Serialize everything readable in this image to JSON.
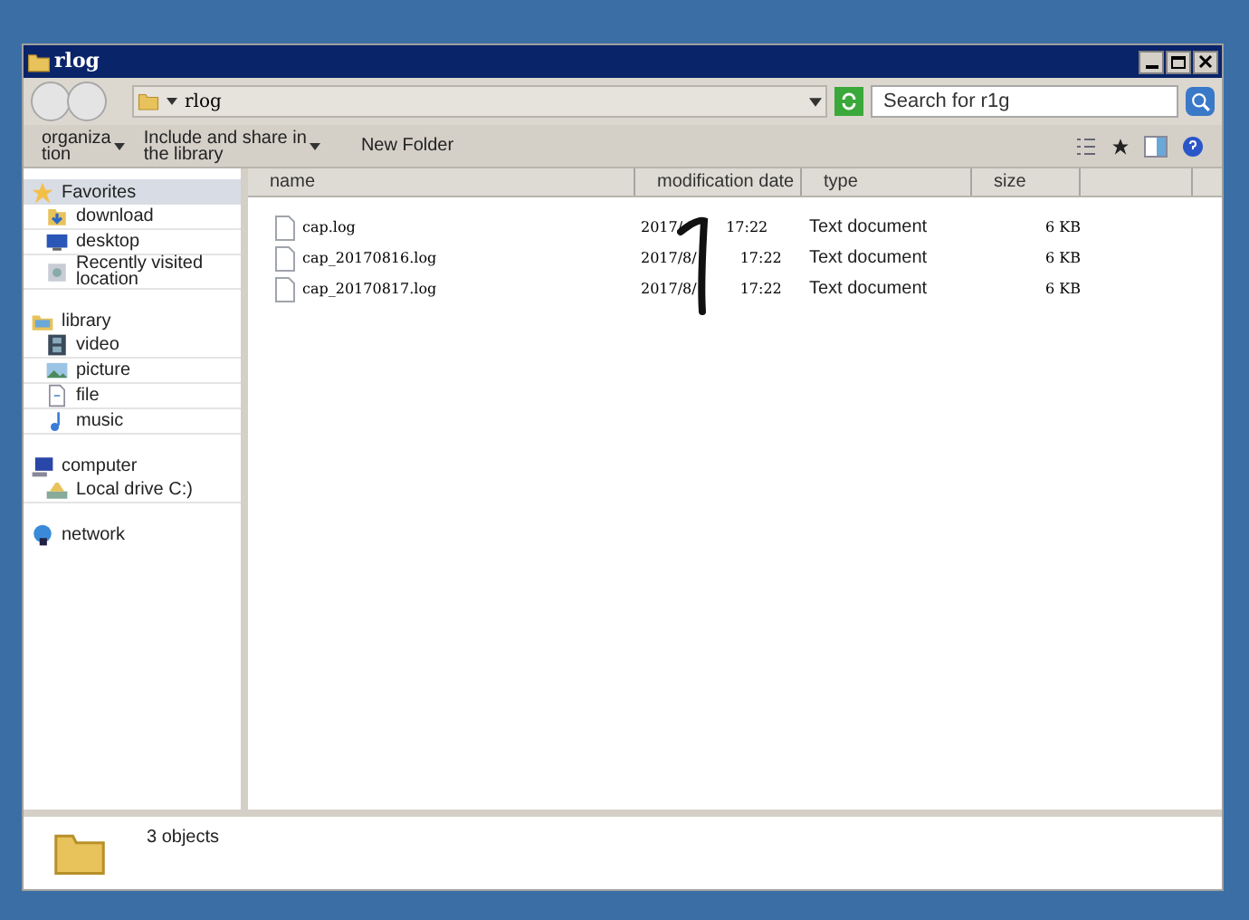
{
  "window": {
    "title": "rlog"
  },
  "address": {
    "path": "rlog"
  },
  "search": {
    "placeholder": "Search for r1g"
  },
  "toolbar": [
    {
      "lines": [
        "organiza",
        "tion"
      ]
    },
    {
      "lines": [
        "Include and share in",
        "the library"
      ]
    },
    {
      "lines": [
        "New Folder"
      ]
    }
  ],
  "sidebar": {
    "groups": [
      {
        "label": "Favorites",
        "selected": true,
        "children": [
          {
            "label": "download"
          },
          {
            "label": "desktop"
          },
          {
            "label": "Recently visited\nlocation"
          }
        ]
      },
      {
        "label": "library",
        "selected": false,
        "children": [
          {
            "label": "video"
          },
          {
            "label": "picture"
          },
          {
            "label": "file"
          },
          {
            "label": "music"
          }
        ]
      },
      {
        "label": "computer",
        "selected": false,
        "children": [
          {
            "label": "Local drive C:)"
          }
        ]
      },
      {
        "label": "network",
        "selected": false
      }
    ]
  },
  "table": {
    "columns": [
      "name",
      "modification date",
      "type",
      "size"
    ],
    "rows": [
      {
        "name": "cap.log",
        "date": "2017/",
        "time": "17:22",
        "type": "Text document",
        "size": "6 KB"
      },
      {
        "name": "cap_20170816.log",
        "date": "2017/8/",
        "time": "17:22",
        "type": "Text document",
        "size": "6 KB"
      },
      {
        "name": "cap_20170817.log",
        "date": "2017/8/",
        "time": "17:22",
        "type": "Text document",
        "size": "6 KB"
      }
    ]
  },
  "status_bar": {
    "text": "3 objects"
  }
}
